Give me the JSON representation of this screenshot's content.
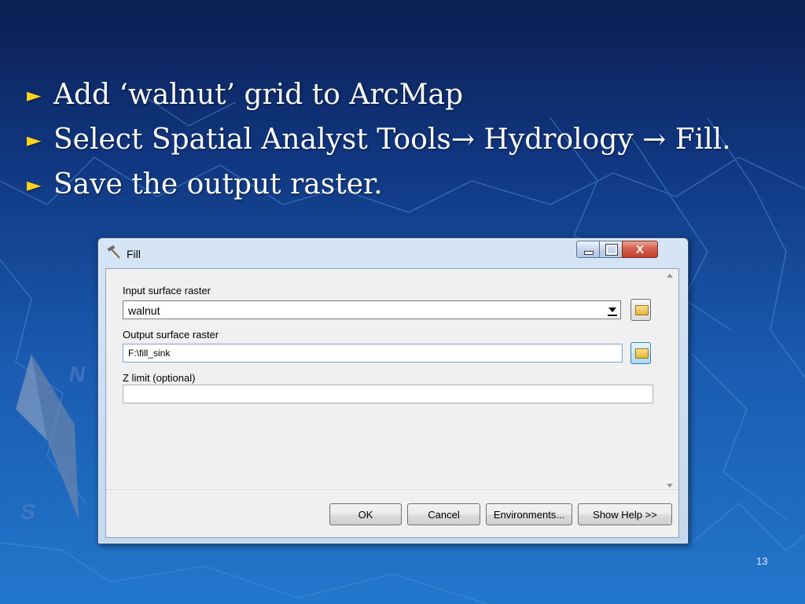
{
  "slide": {
    "bullets": [
      "Add ‘walnut’ grid to ArcMap",
      "Select Spatial Analyst Tools→ Hydrology → Fill.",
      "Save the output raster."
    ],
    "bullet_marker": "►",
    "page_number": "13"
  },
  "dialog": {
    "title": "Fill",
    "title_icon": "hammer-icon",
    "fields": {
      "input_label": "Input surface raster",
      "input_value": "walnut",
      "output_label": "Output surface raster",
      "output_value": "F:\\fill_sink",
      "zlimit_label": "Z limit (optional)",
      "zlimit_value": ""
    },
    "buttons": {
      "ok": "OK",
      "cancel": "Cancel",
      "environments": "Environments...",
      "help": "Show Help >>"
    },
    "window_controls": {
      "close_glyph": "X"
    }
  },
  "colors": {
    "bullet_marker": "#ffd21a",
    "close_button": "#c1412b",
    "background_top": "#0b1f52",
    "background_bottom": "#2277cc"
  }
}
